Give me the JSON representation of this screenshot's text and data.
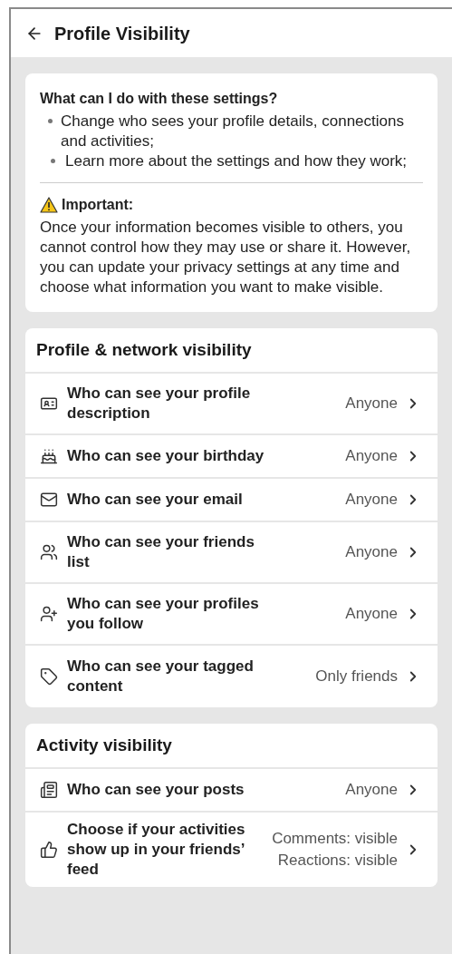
{
  "header": {
    "title": "Profile Visibility"
  },
  "info": {
    "heading": "What can I do with these settings?",
    "bullets": [
      "Change who sees your profile details, connections and activities;",
      "Learn more about the settings and how they work;"
    ],
    "warning_title": "Important:",
    "warning_text": "Once your information becomes visible to others, you cannot control how they may use or share it. However, you can update your privacy settings at any time and choose what information you want to make visible."
  },
  "sections": [
    {
      "title": "Profile & network visibility",
      "rows": [
        {
          "label": "Who can see your profile description",
          "values": [
            "Anyone"
          ]
        },
        {
          "label": "Who can see your birthday",
          "values": [
            "Anyone"
          ]
        },
        {
          "label": "Who can see your email",
          "values": [
            "Anyone"
          ]
        },
        {
          "label": "Who can see your friends list",
          "values": [
            "Anyone"
          ]
        },
        {
          "label": "Who can see your profiles you follow",
          "values": [
            "Anyone"
          ]
        },
        {
          "label": "Who can see your tagged content",
          "values": [
            "Only friends"
          ]
        }
      ]
    },
    {
      "title": "Activity visibility",
      "rows": [
        {
          "label": "Who can see your posts",
          "values": [
            "Anyone"
          ]
        },
        {
          "label": "Choose if your activities show up in your friends’ feed",
          "values": [
            "Comments: visible",
            "Reactions: visible"
          ]
        }
      ]
    }
  ]
}
